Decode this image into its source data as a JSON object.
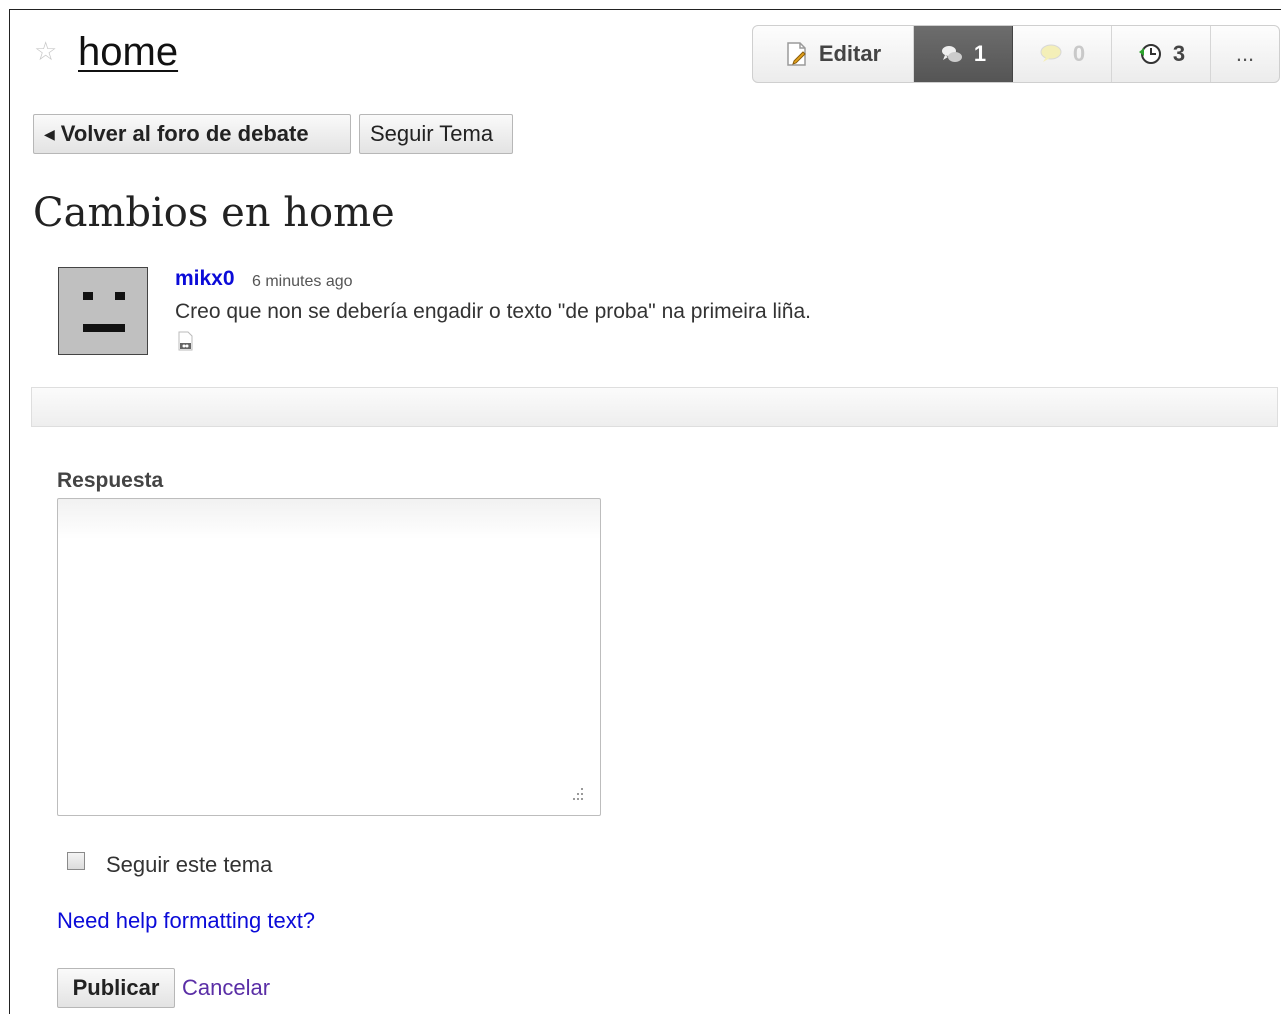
{
  "page": {
    "title": "home"
  },
  "toolbar": {
    "edit_label": "Editar",
    "talk_count": "1",
    "comments_count": "0",
    "history_count": "3",
    "more_label": "..."
  },
  "nav": {
    "back_label": "Volver al foro de debate",
    "follow_label": "Seguir Tema"
  },
  "topic": {
    "title": "Cambios en home"
  },
  "post": {
    "author": "mikx0",
    "time": "6 minutes ago",
    "text": "Creo que non se debería engadir o texto \"de proba\" na primeira liña."
  },
  "reply": {
    "label": "Respuesta",
    "value": "",
    "follow_checkbox_label": "Seguir este tema",
    "follow_checked": false,
    "help_link": "Need help formatting text?",
    "publish_label": "Publicar",
    "cancel_label": "Cancelar"
  },
  "colors": {
    "link": "#0b0bd8",
    "visited_link": "#5a2ea6",
    "active_tab": "#5e5e5e"
  }
}
